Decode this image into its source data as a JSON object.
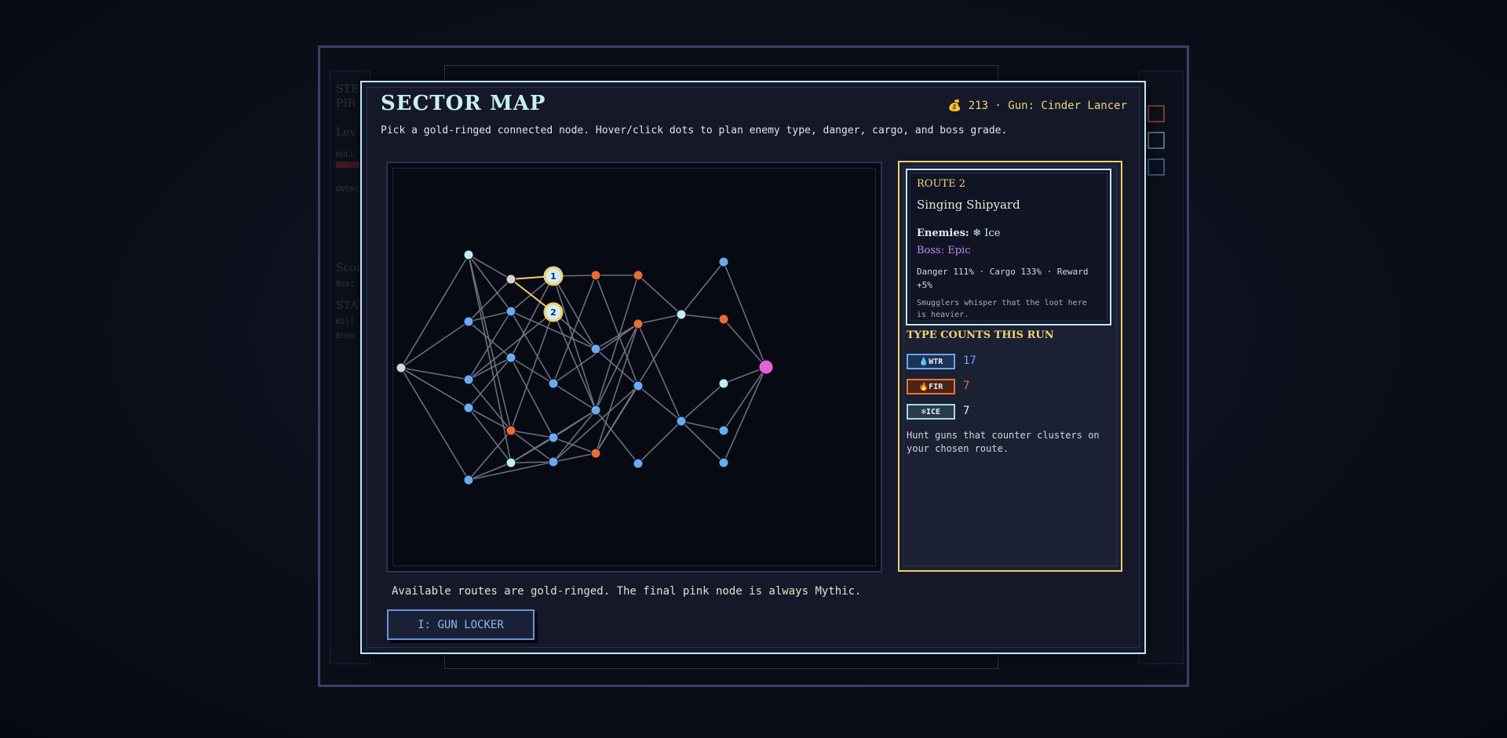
{
  "background": {
    "ghost_texts": [
      "STE",
      "PIR",
      "Lev",
      "HULL",
      "OVERC",
      "Scor",
      "Best",
      "STAT",
      "Kill",
      "Enem"
    ]
  },
  "modal": {
    "title": "SECTOR MAP",
    "status": "💰 213 · Gun: Cinder Lancer",
    "subtitle": "Pick a gold-ringed connected node. Hover/click dots to plan enemy type, danger, cargo, and boss grade.",
    "map_caption": "Available routes are gold-ringed. The final pink node is always Mythic.",
    "locker_button": "I: GUN LOCKER"
  },
  "route_card": {
    "label": "ROUTE 2",
    "name": "Singing Shipyard",
    "enemies_label": "Enemies:",
    "enemies_value": "❄ Ice",
    "boss": "Boss: Epic",
    "stats": "Danger 111% · Cargo 133% · Reward +5%",
    "note": "Smugglers whisper that the loot here is heavier."
  },
  "type_counts": {
    "title": "TYPE COUNTS THIS RUN",
    "items": [
      {
        "chip": "💧WTR",
        "count": "17",
        "color": "#6aa6f0",
        "border": "#6aa6f0",
        "bg": "#1d3258"
      },
      {
        "chip": "🔥FIR",
        "count": "7",
        "color": "#e6733a",
        "border": "#e6733a",
        "bg": "#4a2416"
      },
      {
        "chip": "❄ICE",
        "count": "7",
        "color": "#e8f4f8",
        "border": "#a8d8e6",
        "bg": "#2a3c48"
      }
    ],
    "hint": "Hunt guns that counter clusters on your chosen route."
  },
  "map": {
    "colors": {
      "water": "#6aaaf2",
      "fire": "#e86c36",
      "ice": "#bdeef8",
      "neutral": "#d9d7cc",
      "mythic": "#e264d4",
      "available_ring": "#f0cf6a",
      "edge": "#7c7f8e",
      "path": "#f0cf6a"
    },
    "nodes": [
      {
        "id": "start",
        "type": "neutral"
      },
      {
        "id": "c1a",
        "type": "ice"
      },
      {
        "id": "c1b",
        "type": "water"
      },
      {
        "id": "c1c",
        "type": "water"
      },
      {
        "id": "c1d",
        "type": "water"
      },
      {
        "id": "c1e",
        "type": "water"
      },
      {
        "id": "c2a",
        "type": "neutral"
      },
      {
        "id": "c2b",
        "type": "water"
      },
      {
        "id": "c2c",
        "type": "water"
      },
      {
        "id": "c2d",
        "type": "fire"
      },
      {
        "id": "c2e",
        "type": "ice"
      },
      {
        "id": "r1",
        "type": "ice",
        "label": "1",
        "available": true
      },
      {
        "id": "r2",
        "type": "ice",
        "label": "2",
        "available": true
      },
      {
        "id": "c3c",
        "type": "water"
      },
      {
        "id": "c3d",
        "type": "water"
      },
      {
        "id": "c3e",
        "type": "water"
      },
      {
        "id": "c4a",
        "type": "fire"
      },
      {
        "id": "c4b",
        "type": "water"
      },
      {
        "id": "c4c",
        "type": "water"
      },
      {
        "id": "c4d",
        "type": "fire"
      },
      {
        "id": "c5a",
        "type": "fire"
      },
      {
        "id": "c5b",
        "type": "fire"
      },
      {
        "id": "c5c",
        "type": "water"
      },
      {
        "id": "c5d",
        "type": "water"
      },
      {
        "id": "c6a",
        "type": "ice"
      },
      {
        "id": "c6b",
        "type": "water"
      },
      {
        "id": "c7a",
        "type": "water"
      },
      {
        "id": "c7b",
        "type": "fire"
      },
      {
        "id": "c7c",
        "type": "ice"
      },
      {
        "id": "c7d",
        "type": "water"
      },
      {
        "id": "c7e",
        "type": "water"
      },
      {
        "id": "boss",
        "type": "mythic"
      }
    ],
    "edges": [
      [
        "start",
        "c1a"
      ],
      [
        "start",
        "c1b"
      ],
      [
        "start",
        "c1c"
      ],
      [
        "start",
        "c1d"
      ],
      [
        "start",
        "c1e"
      ],
      [
        "c1a",
        "c2a"
      ],
      [
        "c1a",
        "c2b"
      ],
      [
        "c1a",
        "c2d"
      ],
      [
        "c1a",
        "c2e"
      ],
      [
        "c1b",
        "c2a"
      ],
      [
        "c1b",
        "c2b"
      ],
      [
        "c1b",
        "c2c"
      ],
      [
        "c1c",
        "c2b"
      ],
      [
        "c1c",
        "c2c"
      ],
      [
        "c1c",
        "c2d"
      ],
      [
        "c1c",
        "r2"
      ],
      [
        "c1d",
        "c2c"
      ],
      [
        "c1d",
        "c2d"
      ],
      [
        "c1d",
        "c2e"
      ],
      [
        "c1e",
        "c2d"
      ],
      [
        "c1e",
        "c2e"
      ],
      [
        "c1e",
        "c3e"
      ],
      [
        "c2a",
        "r1"
      ],
      [
        "c2a",
        "r2"
      ],
      [
        "c2b",
        "r1"
      ],
      [
        "c2b",
        "c3c"
      ],
      [
        "c2b",
        "c4b"
      ],
      [
        "c2c",
        "c3c"
      ],
      [
        "c2c",
        "c3d"
      ],
      [
        "c2c",
        "r1"
      ],
      [
        "c2d",
        "c3d"
      ],
      [
        "c2d",
        "c3e"
      ],
      [
        "c2d",
        "r2"
      ],
      [
        "c2e",
        "c3e"
      ],
      [
        "c2e",
        "c4c"
      ],
      [
        "c2e",
        "c3d"
      ],
      [
        "r1",
        "c4a"
      ],
      [
        "r1",
        "c4b"
      ],
      [
        "r1",
        "c4c"
      ],
      [
        "r2",
        "c4b"
      ],
      [
        "r2",
        "c4c"
      ],
      [
        "c3c",
        "c4a"
      ],
      [
        "c3c",
        "c4c"
      ],
      [
        "c3c",
        "c5b"
      ],
      [
        "c3d",
        "c4c"
      ],
      [
        "c3d",
        "c4d"
      ],
      [
        "c3e",
        "c4c"
      ],
      [
        "c3e",
        "c4d"
      ],
      [
        "c3e",
        "c5c"
      ],
      [
        "c4a",
        "c5a"
      ],
      [
        "c4a",
        "c5c"
      ],
      [
        "c4b",
        "c5b"
      ],
      [
        "c4b",
        "c5c"
      ],
      [
        "c4c",
        "c5b"
      ],
      [
        "c4c",
        "c5d"
      ],
      [
        "c4c",
        "c5a"
      ],
      [
        "c4d",
        "c5b"
      ],
      [
        "c4d",
        "c5c"
      ],
      [
        "c4d",
        "c6a"
      ],
      [
        "c5a",
        "c6a"
      ],
      [
        "c5b",
        "c6a"
      ],
      [
        "c5b",
        "c6b"
      ],
      [
        "c5c",
        "c6b"
      ],
      [
        "c5d",
        "c6b"
      ],
      [
        "c6a",
        "c7a"
      ],
      [
        "c6a",
        "c7b"
      ],
      [
        "c6b",
        "c7c"
      ],
      [
        "c6b",
        "c7d"
      ],
      [
        "c7a",
        "boss"
      ],
      [
        "c7b",
        "boss"
      ],
      [
        "c7c",
        "boss"
      ],
      [
        "c7d",
        "boss"
      ],
      [
        "c7e",
        "boss"
      ],
      [
        "c6b",
        "c7e"
      ]
    ],
    "highlighted_path": [
      [
        "c2a",
        "r1"
      ],
      [
        "c2a",
        "r2"
      ]
    ]
  }
}
